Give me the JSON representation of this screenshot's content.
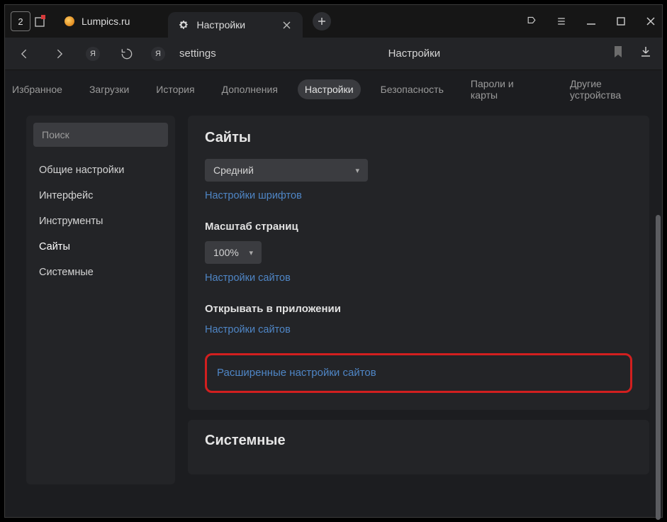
{
  "titlebar": {
    "tab_count": "2",
    "inactive_tab_label": "Lumpics.ru",
    "active_tab_label": "Настройки"
  },
  "addrbar": {
    "path": "settings",
    "center_title": "Настройки"
  },
  "catnav": {
    "items": [
      "Избранное",
      "Загрузки",
      "История",
      "Дополнения",
      "Настройки",
      "Безопасность",
      "Пароли и карты",
      "Другие устройства"
    ],
    "active_index": 4
  },
  "sidebar": {
    "search_placeholder": "Поиск",
    "items": [
      "Общие настройки",
      "Интерфейс",
      "Инструменты",
      "Сайты",
      "Системные"
    ],
    "active_index": 3
  },
  "sites_panel": {
    "heading": "Сайты",
    "font_size_value": "Средний",
    "font_settings_link": "Настройки шрифтов",
    "zoom_label": "Масштаб страниц",
    "zoom_value": "100%",
    "zoom_settings_link": "Настройки сайтов",
    "open_in_app_label": "Открывать в приложении",
    "open_in_app_link": "Настройки сайтов",
    "advanced_link": "Расширенные настройки сайтов"
  },
  "system_panel": {
    "heading": "Системные"
  }
}
